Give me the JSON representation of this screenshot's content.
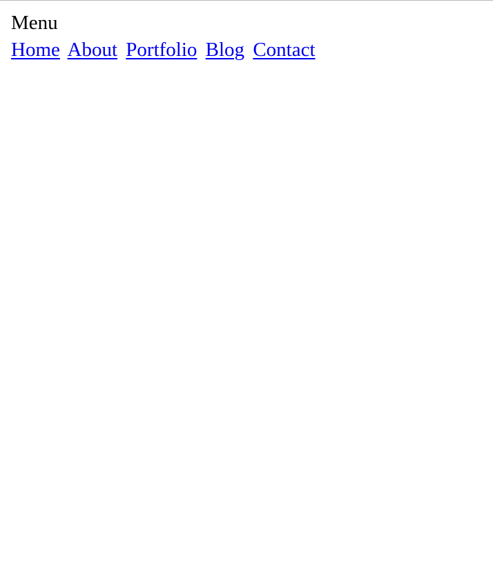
{
  "menu": {
    "title": "Menu"
  },
  "nav": {
    "items": [
      {
        "label": "Home"
      },
      {
        "label": "About"
      },
      {
        "label": "Portfolio"
      },
      {
        "label": "Blog"
      },
      {
        "label": "Contact"
      }
    ]
  },
  "colors": {
    "link": "#0000ee",
    "text": "#000000",
    "background": "#ffffff"
  }
}
